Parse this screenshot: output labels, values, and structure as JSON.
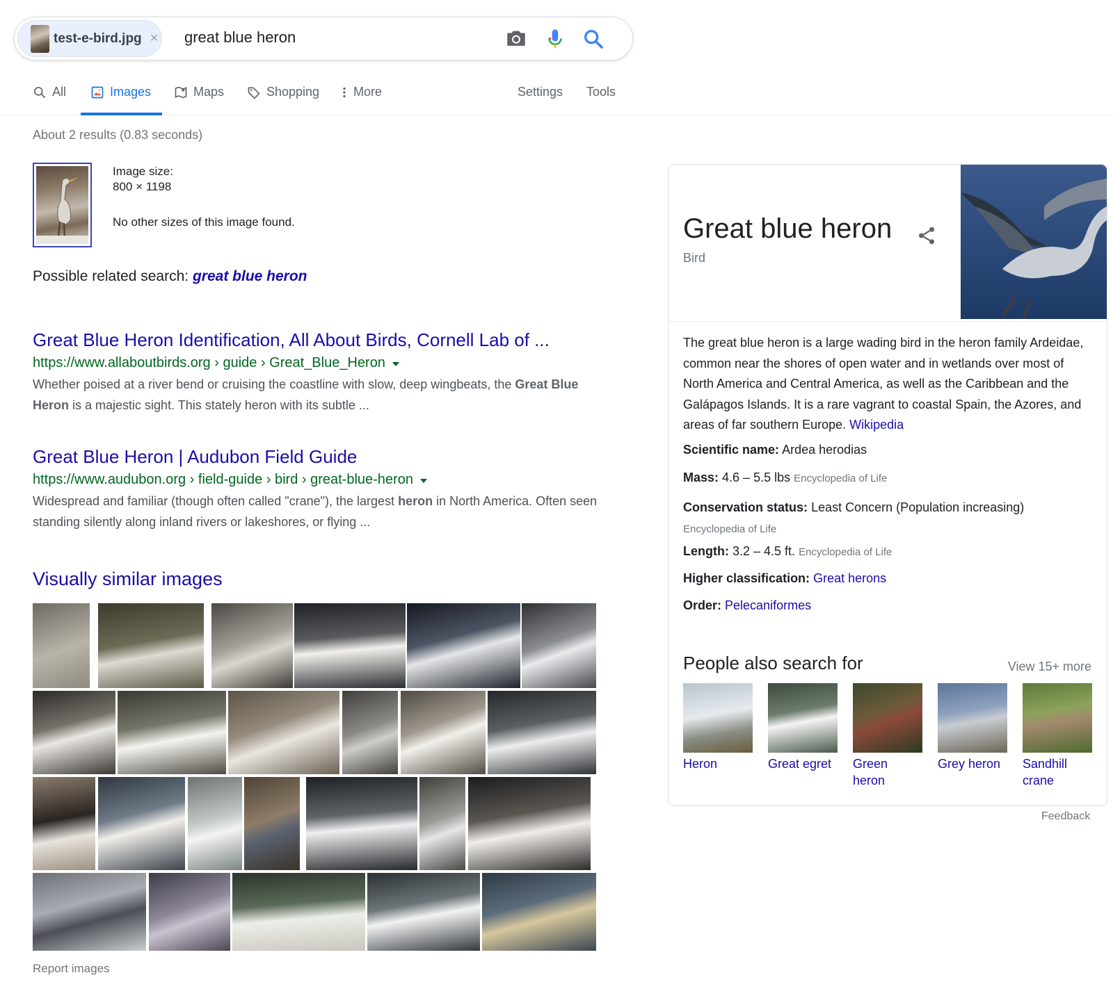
{
  "search": {
    "file_name": "test-e-bird.jpg",
    "query": "great blue heron",
    "remove_glyph": "×"
  },
  "tabs": [
    {
      "label": "All",
      "icon": "search-icon"
    },
    {
      "label": "Images",
      "icon": "image-icon",
      "active": true
    },
    {
      "label": "Maps",
      "icon": "map-icon"
    },
    {
      "label": "Shopping",
      "icon": "tag-icon"
    },
    {
      "label": "More",
      "icon": "more-vertical-icon"
    }
  ],
  "tools": {
    "settings": "Settings",
    "tools": "Tools"
  },
  "stats": "About 2 results (0.83 seconds)",
  "image_info": {
    "size_label": "Image size:",
    "size_value": "800 × 1198",
    "other_sizes": "No other sizes of this image found."
  },
  "related": {
    "prefix": "Possible related search:",
    "term": "great blue heron"
  },
  "results": [
    {
      "title": "Great Blue Heron Identification, All About Birds, Cornell Lab of ...",
      "url": "https://www.allaboutbirds.org › guide › Great_Blue_Heron",
      "snippet_pre": "Whether poised at a river bend or cruising the coastline with slow, deep wingbeats, the ",
      "snippet_bold": "Great Blue Heron",
      "snippet_post": " is a majestic sight. This stately heron with its subtle ..."
    },
    {
      "title": "Great Blue Heron | Audubon Field Guide",
      "url": "https://www.audubon.org › field-guide › bird › great-blue-heron",
      "snippet_pre": "Widespread and familiar (though often called \"crane\"), the largest ",
      "snippet_bold": "heron",
      "snippet_post": " in North America. Often seen standing silently along inland rivers or lakeshores, or flying ..."
    }
  ],
  "visually_similar": {
    "title": "Visually similar images",
    "report": "Report images"
  },
  "knowledge_panel": {
    "title": "Great blue heron",
    "subtitle": "Bird",
    "description": "The great blue heron is a large wading bird in the heron family Ardeidae, common near the shores of open water and in wetlands over most of North America and Central America, as well as the Caribbean and the Galápagos Islands. It is a rare vagrant to coastal Spain, the Azores, and areas of far southern Europe.",
    "source_link": "Wikipedia",
    "facts": [
      {
        "key": "Scientific name:",
        "value": "Ardea herodias",
        "source": ""
      },
      {
        "key": "Mass:",
        "value": "4.6 – 5.5 lbs",
        "source": "Encyclopedia of Life"
      },
      {
        "key": "Conservation status:",
        "value": "Least Concern (Population increasing)",
        "source": "Encyclopedia of Life"
      },
      {
        "key": "Length:",
        "value": "3.2 – 4.5 ft.",
        "source": "Encyclopedia of Life"
      },
      {
        "key": "Higher classification:",
        "value": "Great herons",
        "source": "",
        "link": true
      },
      {
        "key": "Order:",
        "value": "Pelecaniformes",
        "source": "",
        "link": true
      }
    ],
    "people_also_search": {
      "title": "People also search for",
      "more": "View 15+ more",
      "items": [
        {
          "label": "Heron"
        },
        {
          "label": "Great egret"
        },
        {
          "label": "Green heron"
        },
        {
          "label": "Grey heron"
        },
        {
          "label": "Sandhill crane"
        }
      ]
    },
    "feedback": "Feedback"
  },
  "colors": {
    "link": "#1a0dab",
    "url": "#006621",
    "accent": "#1a73e8",
    "muted": "#70757a"
  }
}
